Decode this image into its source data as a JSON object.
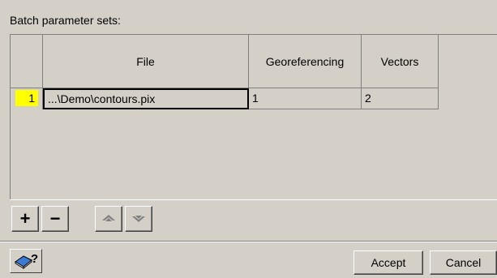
{
  "section_label": "Batch parameter sets:",
  "table": {
    "columns": [
      "File",
      "Georeferencing",
      "Vectors"
    ],
    "rows": [
      {
        "index": "1",
        "file": "...\\Demo\\contours.pix",
        "georeferencing": "1",
        "vectors": "2"
      }
    ]
  },
  "toolbar": {
    "add_label": "+",
    "remove_label": "−"
  },
  "buttons": {
    "accept_label": "Accept",
    "cancel_label": "Cancel"
  },
  "colors": {
    "row_index_highlight": "#ffff00",
    "dialog_bg": "#d4d0c8"
  },
  "icons": {
    "help": "help-book-icon",
    "move_up": "move-up-icon",
    "move_down": "move-down-icon"
  }
}
